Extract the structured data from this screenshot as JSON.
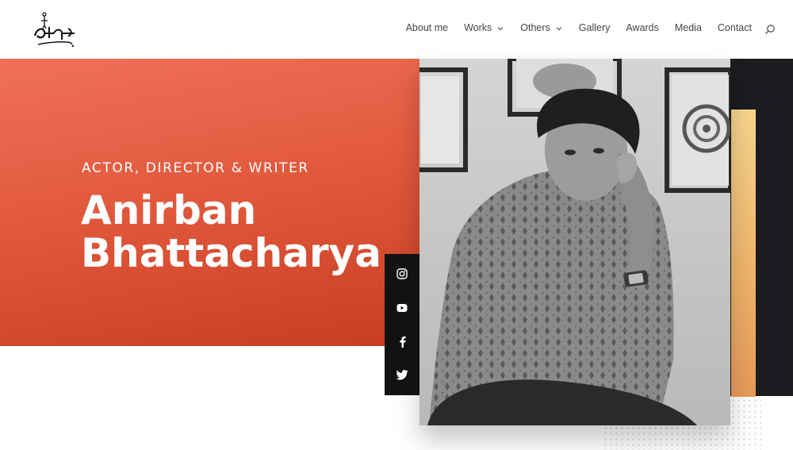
{
  "nav": {
    "items": [
      {
        "label": "About me",
        "has_dropdown": false
      },
      {
        "label": "Works",
        "has_dropdown": true
      },
      {
        "label": "Others",
        "has_dropdown": true
      },
      {
        "label": "Gallery",
        "has_dropdown": false
      },
      {
        "label": "Awards",
        "has_dropdown": false
      },
      {
        "label": "Media",
        "has_dropdown": false
      },
      {
        "label": "Contact",
        "has_dropdown": false
      }
    ]
  },
  "hero": {
    "kicker": "ACTOR, DIRECTOR & WRITER",
    "name_line1": "Anirban",
    "name_line2": "Bhattacharya"
  },
  "social": [
    "instagram-icon",
    "youtube-icon",
    "facebook-icon",
    "twitter-icon"
  ],
  "colors": {
    "hero_red": "#e25a3e",
    "dark": "#1a1c1f",
    "gold": "#efb56d"
  }
}
